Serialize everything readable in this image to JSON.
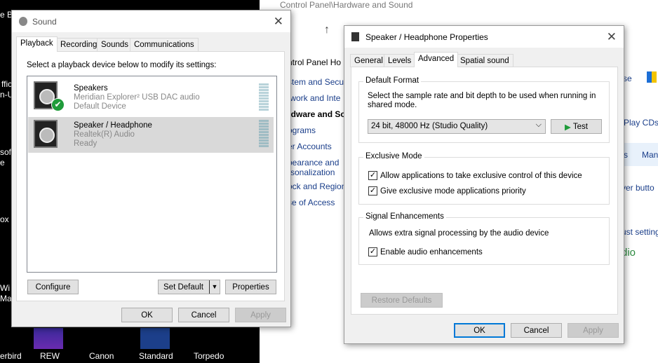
{
  "desktop": {
    "left_fragments": [
      "e Bi",
      "ffic",
      "n-U",
      "sof",
      "e",
      "ox",
      "Wi",
      "Mak"
    ],
    "bottom_icons": [
      "erbird",
      "REW",
      "Canon",
      "Standard",
      "Torpedo"
    ]
  },
  "control_panel": {
    "title": "Control Panel\\Hardware and Sound",
    "nav": [
      "ntrol Panel Ho",
      "stem and Secu",
      "twork and Inte",
      "rdware and So",
      "ograms",
      "er Accounts",
      "pearance and",
      "rsonalization",
      "ock and Region",
      "se of Access"
    ],
    "right": [
      "se",
      "Play CDs",
      "s",
      "Man",
      "ver butto",
      "ust setting",
      "dio"
    ]
  },
  "sound": {
    "title": "Sound",
    "tabs": [
      "Playback",
      "Recording",
      "Sounds",
      "Communications"
    ],
    "instruction": "Select a playback device below to modify its settings:",
    "devices": [
      {
        "name": "Speakers",
        "driver": "Meridian Explorer² USB DAC audio",
        "status": "Default Device"
      },
      {
        "name": "Speaker / Headphone",
        "driver": "Realtek(R) Audio",
        "status": "Ready"
      }
    ],
    "buttons": {
      "configure": "Configure",
      "set_default": "Set Default",
      "properties": "Properties",
      "ok": "OK",
      "cancel": "Cancel",
      "apply": "Apply"
    }
  },
  "props": {
    "title": "Speaker / Headphone Properties",
    "tabs": [
      "General",
      "Levels",
      "Advanced",
      "Spatial sound"
    ],
    "default_format": {
      "legend": "Default Format",
      "desc": "Select the sample rate and bit depth to be used when running in shared mode.",
      "selected": "24 bit, 48000 Hz (Studio Quality)",
      "test": "Test"
    },
    "exclusive": {
      "legend": "Exclusive Mode",
      "opt1": "Allow applications to take exclusive control of this device",
      "opt2": "Give exclusive mode applications priority"
    },
    "signal": {
      "legend": "Signal Enhancements",
      "desc": "Allows extra signal processing by the audio device",
      "opt": "Enable audio enhancements"
    },
    "restore": "Restore Defaults",
    "ok": "OK",
    "cancel": "Cancel",
    "apply": "Apply"
  },
  "colors": {
    "accent": "#0078d7",
    "check_green": "#1f9b3a",
    "link": "#1a3e8a"
  }
}
